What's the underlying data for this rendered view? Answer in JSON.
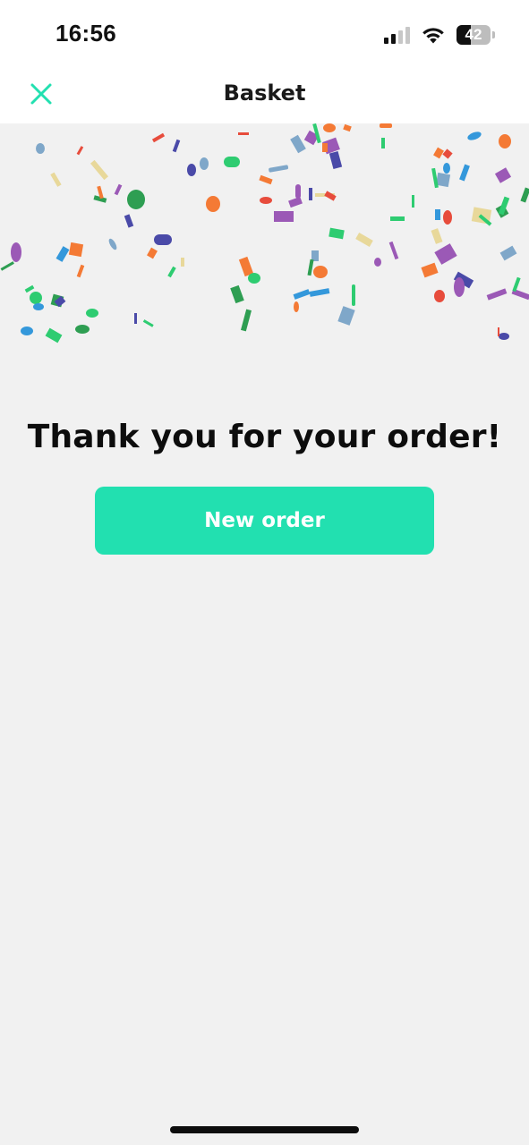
{
  "status_bar": {
    "time": "16:56",
    "battery_level": "42",
    "battery_fraction": 0.42,
    "signal_bars_active": 2,
    "icons": [
      "cellular-signal-icon",
      "wifi-icon",
      "battery-icon"
    ]
  },
  "header": {
    "title": "Basket",
    "close_icon": "close-icon",
    "accent_color": "#22e0b0"
  },
  "main": {
    "title": "Thank you for your order!",
    "new_order_label": "New order",
    "button_color": "#22e0b0"
  },
  "confetti": {
    "colors": [
      "#2ecc71",
      "#f47a35",
      "#9b59b6",
      "#4a4aa8",
      "#e8d89a",
      "#7fa7c9",
      "#e74c3c",
      "#3498db",
      "#2e9e52"
    ]
  }
}
